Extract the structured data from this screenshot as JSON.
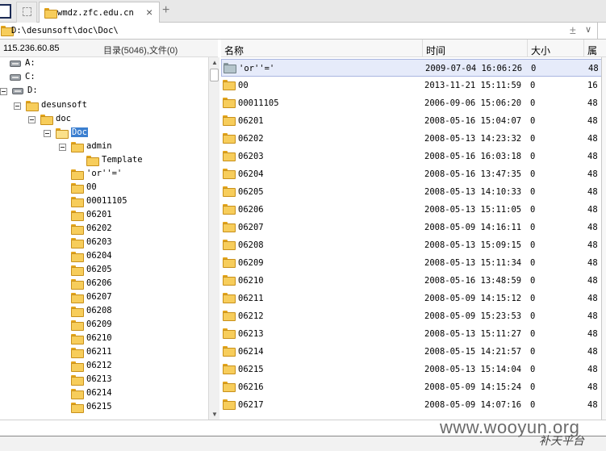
{
  "tabs": {
    "active_label": "wmdz.zfc.edu.cn",
    "close_glyph": "×",
    "add_glyph": "+"
  },
  "address": {
    "path": "D:\\desunsoft\\doc\\Doc\\",
    "plus_glyph": "±",
    "dropdown_glyph": "∨"
  },
  "status": {
    "ip": "115.236.60.85",
    "counts": "目录(5046),文件(0)"
  },
  "columns": {
    "name": "名称",
    "time": "时间",
    "size": "大小",
    "attr": "属性"
  },
  "tree": {
    "drives": [
      "A:",
      "C:",
      "D:"
    ],
    "desunsoft": "desunsoft",
    "doc": "doc",
    "Doc": "Doc",
    "admin": "admin",
    "template": "Template",
    "folders": [
      "'or''='",
      "00",
      "00011105",
      "06201",
      "06202",
      "06203",
      "06204",
      "06205",
      "06206",
      "06207",
      "06208",
      "06209",
      "06210",
      "06211",
      "06212",
      "06213",
      "06214",
      "06215"
    ]
  },
  "files": [
    {
      "name": "'or''='",
      "time": "2009-07-04 16:06:26",
      "size": "0",
      "attr": "48"
    },
    {
      "name": "00",
      "time": "2013-11-21 15:11:59",
      "size": "0",
      "attr": "16"
    },
    {
      "name": "00011105",
      "time": "2006-09-06 15:06:20",
      "size": "0",
      "attr": "48"
    },
    {
      "name": "06201",
      "time": "2008-05-16 15:04:07",
      "size": "0",
      "attr": "48"
    },
    {
      "name": "06202",
      "time": "2008-05-13 14:23:32",
      "size": "0",
      "attr": "48"
    },
    {
      "name": "06203",
      "time": "2008-05-16 16:03:18",
      "size": "0",
      "attr": "48"
    },
    {
      "name": "06204",
      "time": "2008-05-16 13:47:35",
      "size": "0",
      "attr": "48"
    },
    {
      "name": "06205",
      "time": "2008-05-13 14:10:33",
      "size": "0",
      "attr": "48"
    },
    {
      "name": "06206",
      "time": "2008-05-13 15:11:05",
      "size": "0",
      "attr": "48"
    },
    {
      "name": "06207",
      "time": "2008-05-09 14:16:11",
      "size": "0",
      "attr": "48"
    },
    {
      "name": "06208",
      "time": "2008-05-13 15:09:15",
      "size": "0",
      "attr": "48"
    },
    {
      "name": "06209",
      "time": "2008-05-13 15:11:34",
      "size": "0",
      "attr": "48"
    },
    {
      "name": "06210",
      "time": "2008-05-16 13:48:59",
      "size": "0",
      "attr": "48"
    },
    {
      "name": "06211",
      "time": "2008-05-09 14:15:12",
      "size": "0",
      "attr": "48"
    },
    {
      "name": "06212",
      "time": "2008-05-09 15:23:53",
      "size": "0",
      "attr": "48"
    },
    {
      "name": "06213",
      "time": "2008-05-13 15:11:27",
      "size": "0",
      "attr": "48"
    },
    {
      "name": "06214",
      "time": "2008-05-15 14:21:57",
      "size": "0",
      "attr": "48"
    },
    {
      "name": "06215",
      "time": "2008-05-13 15:14:04",
      "size": "0",
      "attr": "48"
    },
    {
      "name": "06216",
      "time": "2008-05-09 14:15:24",
      "size": "0",
      "attr": "48"
    },
    {
      "name": "06217",
      "time": "2008-05-09 14:07:16",
      "size": "0",
      "attr": "48"
    }
  ],
  "watermark": {
    "main": "www.wooyun.org",
    "sub": "补天平台"
  },
  "icons": {
    "folder": "folder-icon",
    "drive": "drive-icon",
    "expander": "collapse-icon"
  },
  "colors": {
    "selection": "#3b7fd0",
    "folder": "#f7cd5b",
    "row_highlight": "#e6ebfa"
  }
}
